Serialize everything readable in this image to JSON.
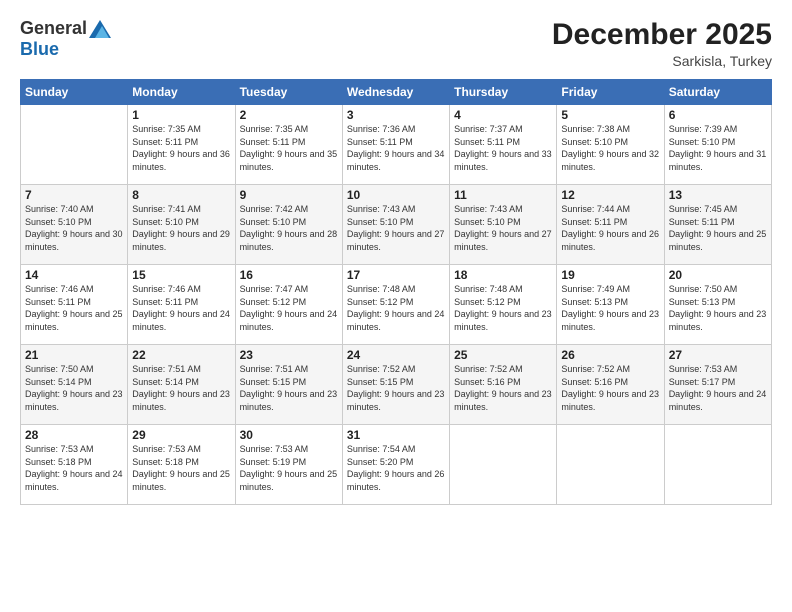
{
  "logo": {
    "general": "General",
    "blue": "Blue"
  },
  "header": {
    "month": "December 2025",
    "location": "Sarkisla, Turkey"
  },
  "weekdays": [
    "Sunday",
    "Monday",
    "Tuesday",
    "Wednesday",
    "Thursday",
    "Friday",
    "Saturday"
  ],
  "weeks": [
    [
      {
        "day": "",
        "sunrise": "",
        "sunset": "",
        "daylight": ""
      },
      {
        "day": "1",
        "sunrise": "Sunrise: 7:35 AM",
        "sunset": "Sunset: 5:11 PM",
        "daylight": "Daylight: 9 hours and 36 minutes."
      },
      {
        "day": "2",
        "sunrise": "Sunrise: 7:35 AM",
        "sunset": "Sunset: 5:11 PM",
        "daylight": "Daylight: 9 hours and 35 minutes."
      },
      {
        "day": "3",
        "sunrise": "Sunrise: 7:36 AM",
        "sunset": "Sunset: 5:11 PM",
        "daylight": "Daylight: 9 hours and 34 minutes."
      },
      {
        "day": "4",
        "sunrise": "Sunrise: 7:37 AM",
        "sunset": "Sunset: 5:11 PM",
        "daylight": "Daylight: 9 hours and 33 minutes."
      },
      {
        "day": "5",
        "sunrise": "Sunrise: 7:38 AM",
        "sunset": "Sunset: 5:10 PM",
        "daylight": "Daylight: 9 hours and 32 minutes."
      },
      {
        "day": "6",
        "sunrise": "Sunrise: 7:39 AM",
        "sunset": "Sunset: 5:10 PM",
        "daylight": "Daylight: 9 hours and 31 minutes."
      }
    ],
    [
      {
        "day": "7",
        "sunrise": "Sunrise: 7:40 AM",
        "sunset": "Sunset: 5:10 PM",
        "daylight": "Daylight: 9 hours and 30 minutes."
      },
      {
        "day": "8",
        "sunrise": "Sunrise: 7:41 AM",
        "sunset": "Sunset: 5:10 PM",
        "daylight": "Daylight: 9 hours and 29 minutes."
      },
      {
        "day": "9",
        "sunrise": "Sunrise: 7:42 AM",
        "sunset": "Sunset: 5:10 PM",
        "daylight": "Daylight: 9 hours and 28 minutes."
      },
      {
        "day": "10",
        "sunrise": "Sunrise: 7:43 AM",
        "sunset": "Sunset: 5:10 PM",
        "daylight": "Daylight: 9 hours and 27 minutes."
      },
      {
        "day": "11",
        "sunrise": "Sunrise: 7:43 AM",
        "sunset": "Sunset: 5:10 PM",
        "daylight": "Daylight: 9 hours and 27 minutes."
      },
      {
        "day": "12",
        "sunrise": "Sunrise: 7:44 AM",
        "sunset": "Sunset: 5:11 PM",
        "daylight": "Daylight: 9 hours and 26 minutes."
      },
      {
        "day": "13",
        "sunrise": "Sunrise: 7:45 AM",
        "sunset": "Sunset: 5:11 PM",
        "daylight": "Daylight: 9 hours and 25 minutes."
      }
    ],
    [
      {
        "day": "14",
        "sunrise": "Sunrise: 7:46 AM",
        "sunset": "Sunset: 5:11 PM",
        "daylight": "Daylight: 9 hours and 25 minutes."
      },
      {
        "day": "15",
        "sunrise": "Sunrise: 7:46 AM",
        "sunset": "Sunset: 5:11 PM",
        "daylight": "Daylight: 9 hours and 24 minutes."
      },
      {
        "day": "16",
        "sunrise": "Sunrise: 7:47 AM",
        "sunset": "Sunset: 5:12 PM",
        "daylight": "Daylight: 9 hours and 24 minutes."
      },
      {
        "day": "17",
        "sunrise": "Sunrise: 7:48 AM",
        "sunset": "Sunset: 5:12 PM",
        "daylight": "Daylight: 9 hours and 24 minutes."
      },
      {
        "day": "18",
        "sunrise": "Sunrise: 7:48 AM",
        "sunset": "Sunset: 5:12 PM",
        "daylight": "Daylight: 9 hours and 23 minutes."
      },
      {
        "day": "19",
        "sunrise": "Sunrise: 7:49 AM",
        "sunset": "Sunset: 5:13 PM",
        "daylight": "Daylight: 9 hours and 23 minutes."
      },
      {
        "day": "20",
        "sunrise": "Sunrise: 7:50 AM",
        "sunset": "Sunset: 5:13 PM",
        "daylight": "Daylight: 9 hours and 23 minutes."
      }
    ],
    [
      {
        "day": "21",
        "sunrise": "Sunrise: 7:50 AM",
        "sunset": "Sunset: 5:14 PM",
        "daylight": "Daylight: 9 hours and 23 minutes."
      },
      {
        "day": "22",
        "sunrise": "Sunrise: 7:51 AM",
        "sunset": "Sunset: 5:14 PM",
        "daylight": "Daylight: 9 hours and 23 minutes."
      },
      {
        "day": "23",
        "sunrise": "Sunrise: 7:51 AM",
        "sunset": "Sunset: 5:15 PM",
        "daylight": "Daylight: 9 hours and 23 minutes."
      },
      {
        "day": "24",
        "sunrise": "Sunrise: 7:52 AM",
        "sunset": "Sunset: 5:15 PM",
        "daylight": "Daylight: 9 hours and 23 minutes."
      },
      {
        "day": "25",
        "sunrise": "Sunrise: 7:52 AM",
        "sunset": "Sunset: 5:16 PM",
        "daylight": "Daylight: 9 hours and 23 minutes."
      },
      {
        "day": "26",
        "sunrise": "Sunrise: 7:52 AM",
        "sunset": "Sunset: 5:16 PM",
        "daylight": "Daylight: 9 hours and 23 minutes."
      },
      {
        "day": "27",
        "sunrise": "Sunrise: 7:53 AM",
        "sunset": "Sunset: 5:17 PM",
        "daylight": "Daylight: 9 hours and 24 minutes."
      }
    ],
    [
      {
        "day": "28",
        "sunrise": "Sunrise: 7:53 AM",
        "sunset": "Sunset: 5:18 PM",
        "daylight": "Daylight: 9 hours and 24 minutes."
      },
      {
        "day": "29",
        "sunrise": "Sunrise: 7:53 AM",
        "sunset": "Sunset: 5:18 PM",
        "daylight": "Daylight: 9 hours and 25 minutes."
      },
      {
        "day": "30",
        "sunrise": "Sunrise: 7:53 AM",
        "sunset": "Sunset: 5:19 PM",
        "daylight": "Daylight: 9 hours and 25 minutes."
      },
      {
        "day": "31",
        "sunrise": "Sunrise: 7:54 AM",
        "sunset": "Sunset: 5:20 PM",
        "daylight": "Daylight: 9 hours and 26 minutes."
      },
      {
        "day": "",
        "sunrise": "",
        "sunset": "",
        "daylight": ""
      },
      {
        "day": "",
        "sunrise": "",
        "sunset": "",
        "daylight": ""
      },
      {
        "day": "",
        "sunrise": "",
        "sunset": "",
        "daylight": ""
      }
    ]
  ]
}
